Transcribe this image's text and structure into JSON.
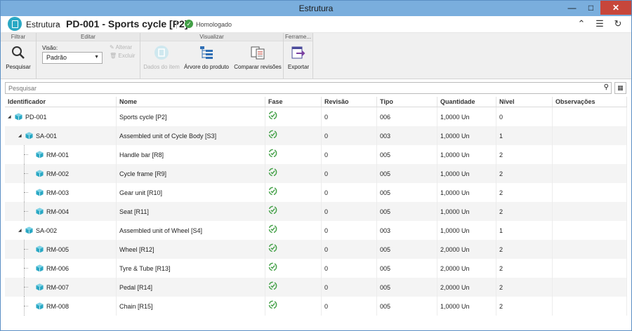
{
  "window": {
    "title": "Estrutura"
  },
  "header": {
    "breadcrumb": "Estrutura",
    "title": "PD-001 - Sports cycle [P2]",
    "status": "Homologado"
  },
  "ribbon": {
    "groups": {
      "filter": "Filtrar",
      "edit": "Editar",
      "view": "Visualizar",
      "tools": "Ferrame..."
    },
    "search_btn": "Pesquisar",
    "view_label": "Visão:",
    "view_value": "Padrão",
    "alter": "Alterar",
    "delete": "Excluir",
    "item_data": "Dados do item",
    "product_tree": "Árvore do produto",
    "compare": "Comparar revisões",
    "export": "Exportar"
  },
  "search": {
    "placeholder": "Pesquisar"
  },
  "table": {
    "columns": [
      "Identificador",
      "Nome",
      "Fase",
      "Revisão",
      "Tipo",
      "Quantidade",
      "Nível",
      "Observações"
    ],
    "rows": [
      {
        "id": "PD-001",
        "name": "Sports cycle [P2]",
        "rev": "0",
        "type": "006",
        "qty": "1,0000 Un",
        "level": "0"
      },
      {
        "id": "SA-001",
        "name": "Assembled unit of Cycle Body [S3]",
        "rev": "0",
        "type": "003",
        "qty": "1,0000 Un",
        "level": "1"
      },
      {
        "id": "RM-001",
        "name": "Handle bar [R8]",
        "rev": "0",
        "type": "005",
        "qty": "1,0000 Un",
        "level": "2"
      },
      {
        "id": "RM-002",
        "name": "Cycle frame [R9]",
        "rev": "0",
        "type": "005",
        "qty": "1,0000 Un",
        "level": "2"
      },
      {
        "id": "RM-003",
        "name": "Gear unit [R10]",
        "rev": "0",
        "type": "005",
        "qty": "1,0000 Un",
        "level": "2"
      },
      {
        "id": "RM-004",
        "name": "Seat [R11]",
        "rev": "0",
        "type": "005",
        "qty": "1,0000 Un",
        "level": "2"
      },
      {
        "id": "SA-002",
        "name": "Assembled unit of Wheel [S4]",
        "rev": "0",
        "type": "003",
        "qty": "1,0000 Un",
        "level": "1"
      },
      {
        "id": "RM-005",
        "name": "Wheel [R12]",
        "rev": "0",
        "type": "005",
        "qty": "2,0000 Un",
        "level": "2"
      },
      {
        "id": "RM-006",
        "name": "Tyre & Tube [R13]",
        "rev": "0",
        "type": "005",
        "qty": "2,0000 Un",
        "level": "2"
      },
      {
        "id": "RM-007",
        "name": "Pedal [R14]",
        "rev": "0",
        "type": "005",
        "qty": "2,0000 Un",
        "level": "2"
      },
      {
        "id": "RM-008",
        "name": "Chain [R15]",
        "rev": "0",
        "type": "005",
        "qty": "1,0000 Un",
        "level": "2"
      }
    ]
  },
  "colors": {
    "titlebar": "#7aaedd",
    "close": "#c7463b",
    "accent": "#2aa8c4",
    "phase_ok": "#43a047"
  }
}
